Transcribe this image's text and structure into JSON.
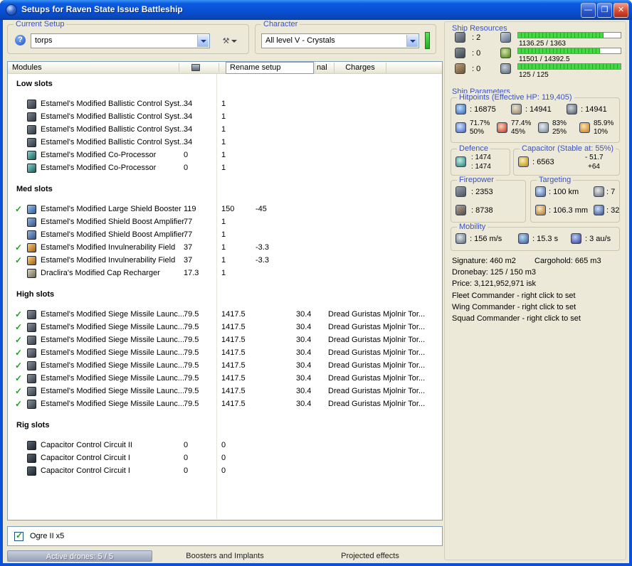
{
  "ui": {
    "check": "✓",
    "tools": "⚒"
  },
  "window": {
    "title": "Setups for Raven State Issue Battleship",
    "controls": {
      "minimize": "—",
      "maximize": "❐",
      "close": "✕"
    }
  },
  "current_setup": {
    "label": "Current Setup",
    "help": "?",
    "selected": "torps"
  },
  "character": {
    "label": "Character",
    "selected": "All level V - Crystals"
  },
  "list": {
    "column_header": "Modules",
    "tabs": {
      "rename": "Rename setup",
      "partial": "nal",
      "charges": "Charges"
    }
  },
  "slot_groups": [
    {
      "title": "Low slots",
      "rows": [
        {
          "check": false,
          "icon": "ballistic-control-icon",
          "name": "Estamel's Modified Ballistic Control Syst...",
          "v1": "34",
          "v2": "1"
        },
        {
          "check": false,
          "icon": "ballistic-control-icon",
          "name": "Estamel's Modified Ballistic Control Syst...",
          "v1": "34",
          "v2": "1"
        },
        {
          "check": false,
          "icon": "ballistic-control-icon",
          "name": "Estamel's Modified Ballistic Control Syst...",
          "v1": "34",
          "v2": "1"
        },
        {
          "check": false,
          "icon": "ballistic-control-icon",
          "name": "Estamel's Modified Ballistic Control Syst...",
          "v1": "34",
          "v2": "1"
        },
        {
          "check": false,
          "icon": "co-processor-icon",
          "name": "Estamel's Modified Co-Processor",
          "v1": "0",
          "v2": "1"
        },
        {
          "check": false,
          "icon": "co-processor-icon",
          "name": "Estamel's Modified Co-Processor",
          "v1": "0",
          "v2": "1"
        }
      ]
    },
    {
      "title": "Med slots",
      "rows": [
        {
          "check": true,
          "icon": "shield-booster-icon",
          "name": "Estamel's Modified Large Shield Booster",
          "v1": "119",
          "v2": "150",
          "v3": "-45"
        },
        {
          "check": false,
          "icon": "shield-boost-amplifier-icon",
          "name": "Estamel's Modified Shield Boost Amplifier",
          "v1": "77",
          "v2": "1"
        },
        {
          "check": false,
          "icon": "shield-boost-amplifier-icon",
          "name": "Estamel's Modified Shield Boost Amplifier",
          "v1": "77",
          "v2": "1"
        },
        {
          "check": true,
          "icon": "invulnerability-field-icon",
          "name": "Estamel's Modified Invulnerability Field",
          "v1": "37",
          "v2": "1",
          "v3": "-3.3"
        },
        {
          "check": true,
          "icon": "invulnerability-field-icon",
          "name": "Estamel's Modified Invulnerability Field",
          "v1": "37",
          "v2": "1",
          "v3": "-3.3"
        },
        {
          "check": false,
          "icon": "cap-recharger-icon",
          "name": "Draclira's Modified Cap Recharger",
          "v1": "17.3",
          "v2": "1"
        }
      ]
    },
    {
      "title": "High slots",
      "rows": [
        {
          "check": true,
          "icon": "siege-missile-launcher-icon",
          "name": "Estamel's Modified Siege Missile Launc...",
          "v1": "79.5",
          "v2": "1417.5",
          "v4": "30.4",
          "charge": "Dread Guristas Mjolnir Tor..."
        },
        {
          "check": true,
          "icon": "siege-missile-launcher-icon",
          "name": "Estamel's Modified Siege Missile Launc...",
          "v1": "79.5",
          "v2": "1417.5",
          "v4": "30.4",
          "charge": "Dread Guristas Mjolnir Tor..."
        },
        {
          "check": true,
          "icon": "siege-missile-launcher-icon",
          "name": "Estamel's Modified Siege Missile Launc...",
          "v1": "79.5",
          "v2": "1417.5",
          "v4": "30.4",
          "charge": "Dread Guristas Mjolnir Tor..."
        },
        {
          "check": true,
          "icon": "siege-missile-launcher-icon",
          "name": "Estamel's Modified Siege Missile Launc...",
          "v1": "79.5",
          "v2": "1417.5",
          "v4": "30.4",
          "charge": "Dread Guristas Mjolnir Tor..."
        },
        {
          "check": true,
          "icon": "siege-missile-launcher-icon",
          "name": "Estamel's Modified Siege Missile Launc...",
          "v1": "79.5",
          "v2": "1417.5",
          "v4": "30.4",
          "charge": "Dread Guristas Mjolnir Tor..."
        },
        {
          "check": true,
          "icon": "siege-missile-launcher-icon",
          "name": "Estamel's Modified Siege Missile Launc...",
          "v1": "79.5",
          "v2": "1417.5",
          "v4": "30.4",
          "charge": "Dread Guristas Mjolnir Tor..."
        },
        {
          "check": true,
          "icon": "siege-missile-launcher-icon",
          "name": "Estamel's Modified Siege Missile Launc...",
          "v1": "79.5",
          "v2": "1417.5",
          "v4": "30.4",
          "charge": "Dread Guristas Mjolnir Tor..."
        },
        {
          "check": true,
          "icon": "siege-missile-launcher-icon",
          "name": "Estamel's Modified Siege Missile Launc...",
          "v1": "79.5",
          "v2": "1417.5",
          "v4": "30.4",
          "charge": "Dread Guristas Mjolnir Tor..."
        }
      ]
    },
    {
      "title": "Rig slots",
      "rows": [
        {
          "check": false,
          "icon": "rig-icon",
          "name": "Capacitor Control Circuit II",
          "v1": "0",
          "v2": "0"
        },
        {
          "check": false,
          "icon": "rig-icon",
          "name": "Capacitor Control Circuit I",
          "v1": "0",
          "v2": "0"
        },
        {
          "check": false,
          "icon": "rig-icon",
          "name": "Capacitor Control Circuit I",
          "v1": "0",
          "v2": "0"
        }
      ]
    }
  ],
  "drones": {
    "label": "Ogre II x5",
    "checked": true
  },
  "bottom_tabs": {
    "drones": "Active drones: 5 / 5",
    "boosters": "Boosters and Implants",
    "projected": "Projected effects"
  },
  "ship_resources": {
    "label": "Ship Resources",
    "hardpoints": [
      {
        "icon": "turret-hardpoints-icon",
        "value": ": 2"
      },
      {
        "icon": "launcher-hardpoints-icon",
        "value": ": 0"
      },
      {
        "icon": "rig-slots-icon",
        "value": ": 0"
      }
    ],
    "bars": [
      {
        "icon": "cpu-icon",
        "value": "1136.25 / 1363",
        "fill": 0.834
      },
      {
        "icon": "powergrid-icon",
        "value": "11501 / 14392.5",
        "fill": 0.799
      },
      {
        "icon": "drone-bandwidth-icon",
        "value": "125 / 125",
        "fill": 1
      }
    ]
  },
  "ship_parameters": {
    "label": "Ship Parameters",
    "hitpoints": {
      "label": "Hitpoints (Effective HP: 119,405)",
      "shield": ": 16875",
      "armor": ": 14941",
      "structure": ": 14941",
      "resists": [
        {
          "icon": "em-resist-icon",
          "shield": "71.7%",
          "armor": "50%"
        },
        {
          "icon": "thermal-resist-icon",
          "shield": "77.4%",
          "armor": "45%"
        },
        {
          "icon": "kinetic-resist-icon",
          "shield": "83%",
          "armor": "25%"
        },
        {
          "icon": "explosive-resist-icon",
          "shield": "85.9%",
          "armor": "10%"
        }
      ]
    },
    "defence": {
      "label": "Defence",
      "value1": ": 1474",
      "value2": ": 1474"
    },
    "capacitor": {
      "label": "Capacitor (Stable at: 55%)",
      "capacity": ": 6563",
      "drain": "- 51.7",
      "recharge": "+64"
    },
    "firepower": {
      "label": "Firepower",
      "volley": ": 2353",
      "dps": ": 8738"
    },
    "targeting": {
      "label": "Targeting",
      "range": ": 100 km",
      "max_targets": ": 7",
      "scan_resolution": ": 106.3 mm",
      "sensor_strength": ": 32"
    },
    "mobility": {
      "label": "Mobility",
      "speed": ": 156 m/s",
      "align_time": ": 15.3 s",
      "warp_speed": ": 3 au/s"
    },
    "info": {
      "signature": "Signature: 460 m2",
      "cargohold": "Cargohold: 665 m3",
      "dronebay": "Dronebay: 125 / 150 m3",
      "price": "Price: 3,121,952,971 isk",
      "fleet": "Fleet Commander - right click to set",
      "wing": "Wing Commander - right click to set",
      "squad": "Squad Commander - right click to set"
    }
  }
}
